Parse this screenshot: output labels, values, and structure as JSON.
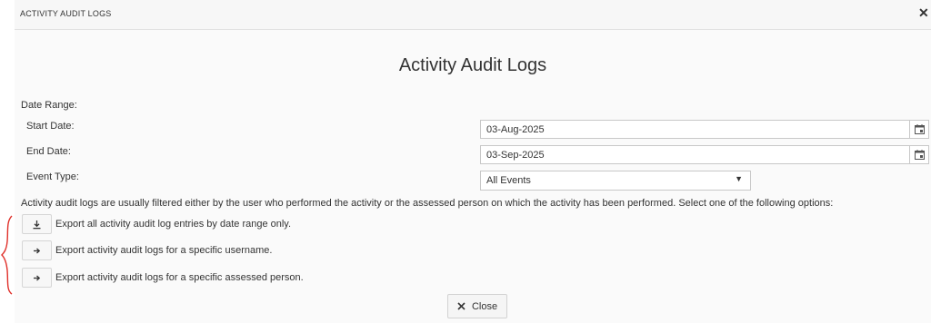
{
  "window": {
    "title": "ACTIVITY AUDIT LOGS",
    "close_glyph": "✕"
  },
  "heading": "Activity Audit Logs",
  "date_range_label": "Date Range:",
  "start_date": {
    "label": "Start Date:",
    "value": "03-Aug-2025",
    "icon": "calendar-icon"
  },
  "end_date": {
    "label": "End Date:",
    "value": "03-Sep-2025",
    "icon": "calendar-icon"
  },
  "event_type": {
    "label": "Event Type:",
    "value": "All Events",
    "caret": "▼"
  },
  "note": "Activity audit logs are usually filtered either by the user who performed the activity or the assessed person on which the activity has been performed. Select one of the following options:",
  "options": [
    {
      "icon": "download-icon",
      "label": "Export all activity audit log entries by date range only."
    },
    {
      "icon": "arrow-right-icon",
      "label": "Export activity audit logs for a specific username."
    },
    {
      "icon": "arrow-right-icon",
      "label": "Export activity audit logs for a specific assessed person."
    }
  ],
  "close_button": {
    "label": "Close",
    "icon": "close-icon"
  },
  "colors": {
    "annotation_brace": "#e0302a"
  }
}
